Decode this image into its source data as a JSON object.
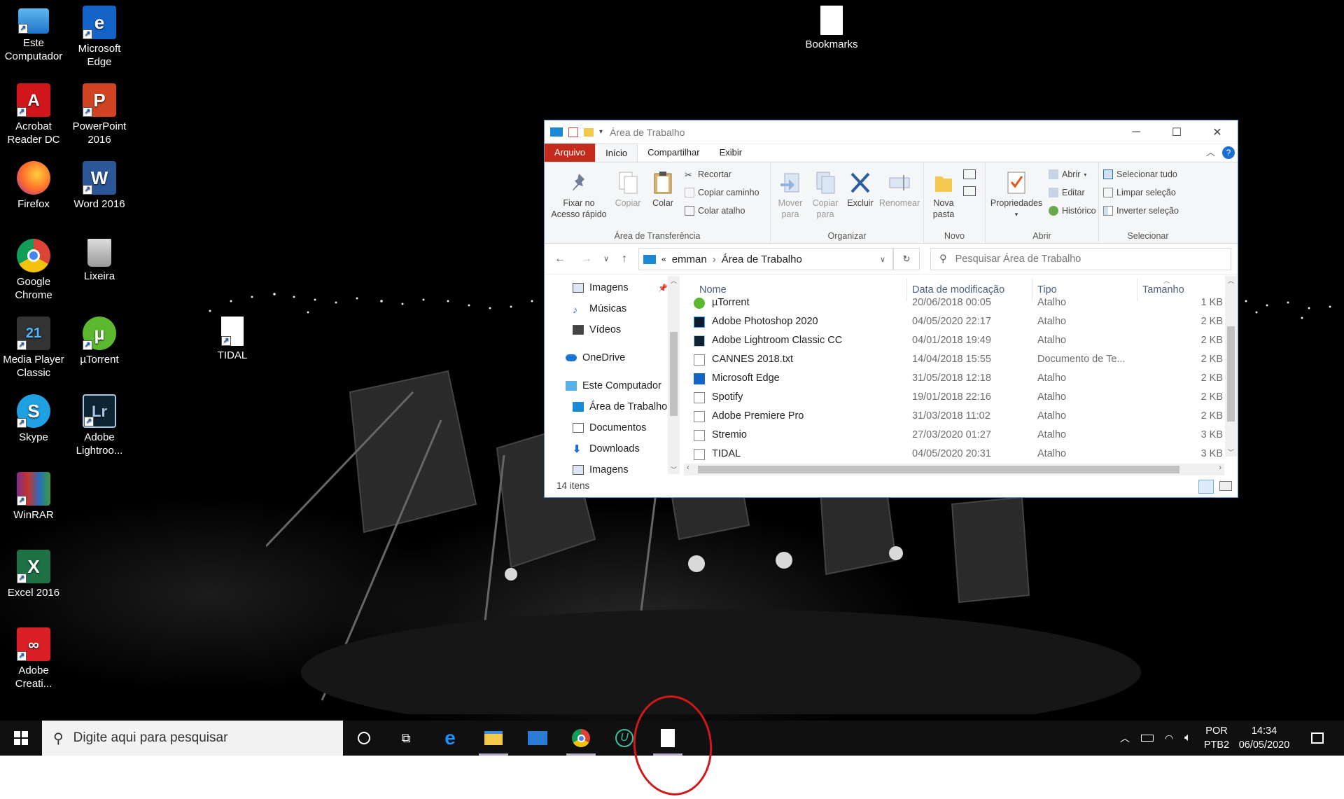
{
  "desktop": {
    "icons": [
      {
        "label": "Este Computador",
        "icon": "computer-icon"
      },
      {
        "label": "Microsoft Edge",
        "icon": "edge-icon"
      },
      {
        "label": "Acrobat Reader DC",
        "icon": "acrobat-icon"
      },
      {
        "label": "PowerPoint 2016",
        "icon": "powerpoint-icon"
      },
      {
        "label": "Firefox",
        "icon": "firefox-icon"
      },
      {
        "label": "Word 2016",
        "icon": "word-icon"
      },
      {
        "label": "Google Chrome",
        "icon": "chrome-icon"
      },
      {
        "label": "Lixeira",
        "icon": "recycle-bin-icon"
      },
      {
        "label": "Media Player Classic",
        "icon": "media-player-icon"
      },
      {
        "label": "µTorrent",
        "icon": "utorrent-icon"
      },
      {
        "label": "TIDAL",
        "icon": "file-icon"
      },
      {
        "label": "Skype",
        "icon": "skype-icon"
      },
      {
        "label": "Adobe Lightroo...",
        "icon": "lightroom-icon"
      },
      {
        "label": "WinRAR",
        "icon": "winrar-icon"
      },
      {
        "label": "Excel 2016",
        "icon": "excel-icon"
      },
      {
        "label": "Adobe Creati...",
        "icon": "creative-cloud-icon"
      },
      {
        "label": "Bookmarks",
        "icon": "file-icon"
      }
    ],
    "colors": {
      "background": "#000000",
      "annotation_circle": "#d01818"
    }
  },
  "explorer": {
    "title": "Área de Trabalho",
    "tabs": [
      "Arquivo",
      "Início",
      "Compartilhar",
      "Exibir"
    ],
    "ribbon": {
      "clipboard": {
        "pin_label_1": "Fixar no",
        "pin_label_2": "Acesso rápido",
        "copy": "Copiar",
        "paste": "Colar",
        "cut": "Recortar",
        "copy_path": "Copiar caminho",
        "paste_shortcut": "Colar atalho",
        "group": "Área de Transferência"
      },
      "organize": {
        "move_1": "Mover",
        "move_2": "para",
        "copyto_1": "Copiar",
        "copyto_2": "para",
        "delete": "Excluir",
        "rename": "Renomear",
        "group": "Organizar"
      },
      "new": {
        "folder_1": "Nova",
        "folder_2": "pasta",
        "group": "Novo"
      },
      "open": {
        "properties": "Propriedades",
        "open": "Abrir",
        "edit": "Editar",
        "history": "Histórico",
        "group": "Abrir"
      },
      "select": {
        "all": "Selecionar tudo",
        "none": "Limpar seleção",
        "invert": "Inverter seleção",
        "group": "Selecionar"
      }
    },
    "address": {
      "chevrons": "«",
      "part1": "emman",
      "part2": "Área de Trabalho"
    },
    "search_placeholder": "Pesquisar Área de Trabalho",
    "nav": [
      "Imagens",
      "Músicas",
      "Vídeos",
      "OneDrive",
      "Este Computador",
      "Área de Trabalho",
      "Documentos",
      "Downloads",
      "Imagens"
    ],
    "columns": {
      "name": "Nome",
      "date": "Data de modificação",
      "type": "Tipo",
      "size": "Tamanho"
    },
    "files": [
      {
        "name": "µTorrent",
        "date": "20/06/2018 00:05",
        "type": "Atalho",
        "size": "1 KB"
      },
      {
        "name": "Adobe Photoshop 2020",
        "date": "04/05/2020 22:17",
        "type": "Atalho",
        "size": "2 KB"
      },
      {
        "name": "Adobe Lightroom Classic CC",
        "date": "04/01/2018 19:49",
        "type": "Atalho",
        "size": "2 KB"
      },
      {
        "name": "CANNES 2018.txt",
        "date": "14/04/2018 15:55",
        "type": "Documento de Te...",
        "size": "2 KB"
      },
      {
        "name": "Microsoft Edge",
        "date": "31/05/2018 12:18",
        "type": "Atalho",
        "size": "2 KB"
      },
      {
        "name": "Spotify",
        "date": "19/01/2018 22:16",
        "type": "Atalho",
        "size": "2 KB"
      },
      {
        "name": "Adobe Premiere Pro",
        "date": "31/03/2018 11:02",
        "type": "Atalho",
        "size": "2 KB"
      },
      {
        "name": "Stremio",
        "date": "27/03/2020 01:27",
        "type": "Atalho",
        "size": "3 KB"
      },
      {
        "name": "TIDAL",
        "date": "04/05/2020 20:31",
        "type": "Atalho",
        "size": "3 KB"
      }
    ],
    "status": "14 itens"
  },
  "taskbar": {
    "search_placeholder": "Digite aqui para pesquisar",
    "apps": [
      "cortana-icon",
      "task-view-icon",
      "edge-icon",
      "file-explorer-icon",
      "mail-icon",
      "chrome-icon",
      "ublock-icon",
      "file-icon"
    ],
    "lang1": "POR",
    "lang2": "PTB2",
    "time": "14:34",
    "date": "06/05/2020"
  }
}
